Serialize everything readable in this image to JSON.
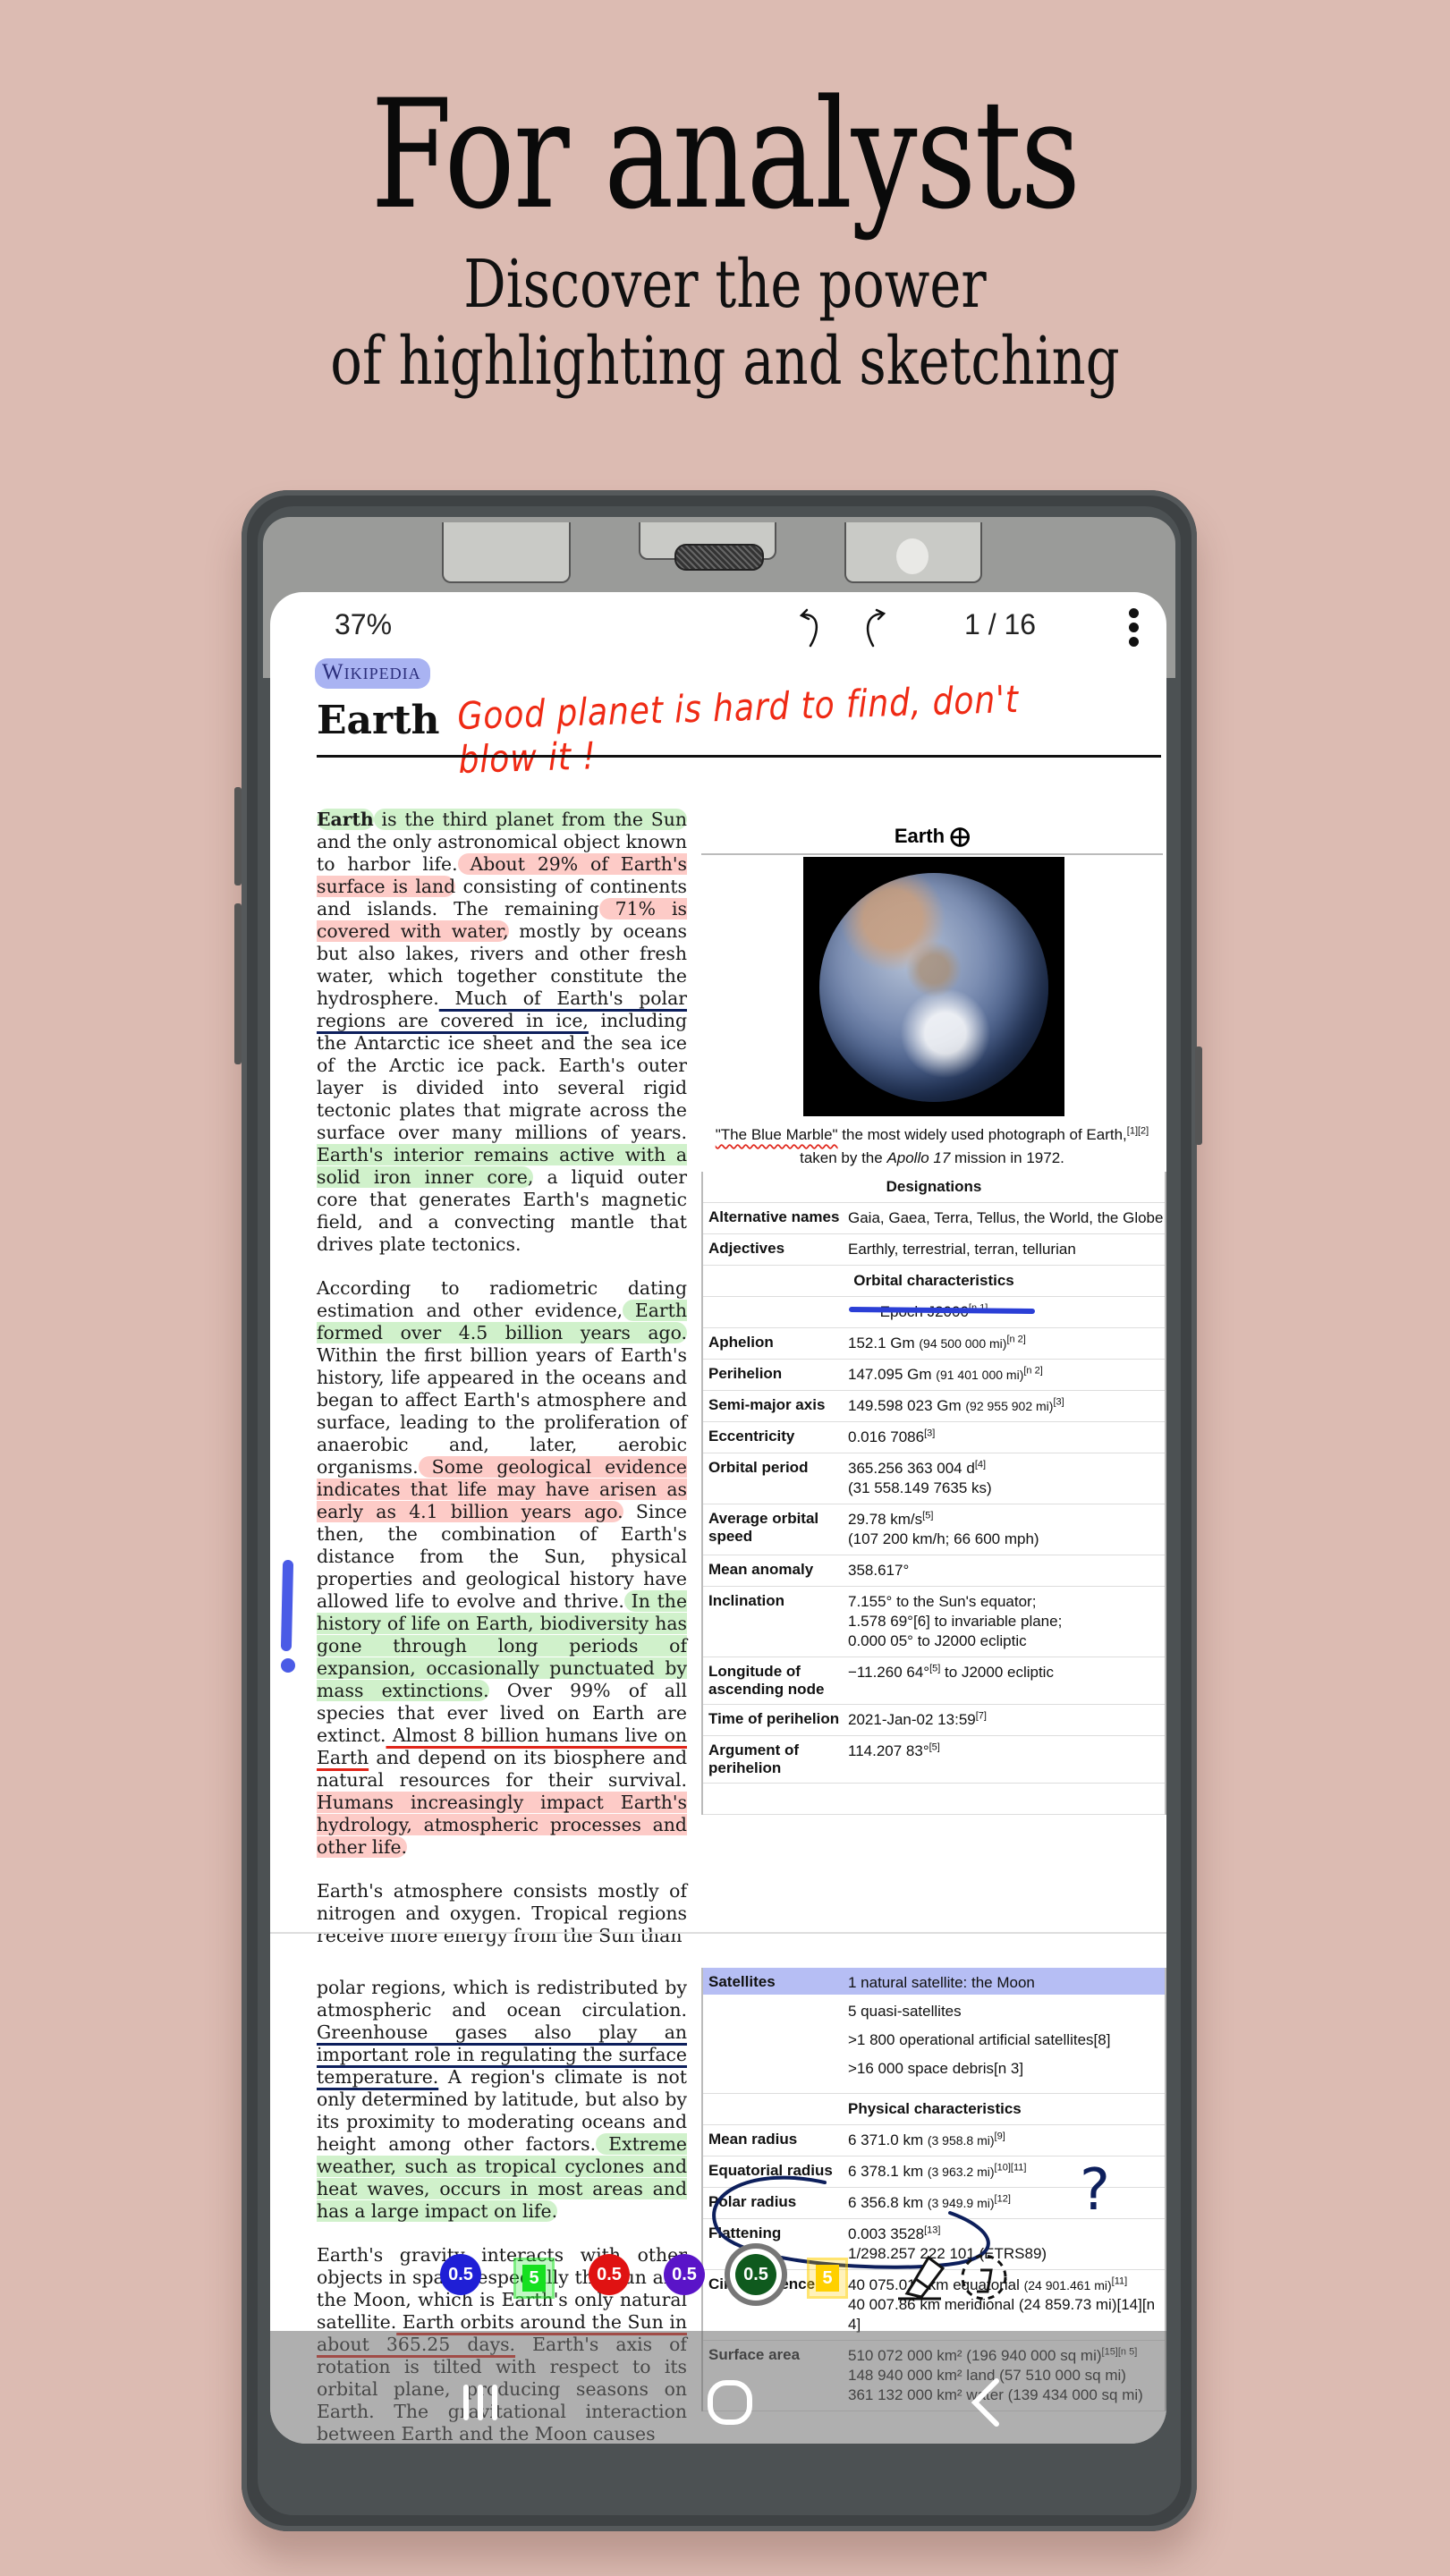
{
  "hero": {
    "title": "For analysts",
    "subtitle_line1": "Discover the power",
    "subtitle_line2": "of highlighting and sketching"
  },
  "viewer": {
    "zoom_level": "37%",
    "page_indicator": "1 / 16",
    "undo_icon": "undo-icon",
    "redo_icon": "redo-icon",
    "menu_icon": "kebab-menu-icon"
  },
  "article": {
    "logo": "Wikipedia",
    "title": "Earth",
    "handwritten_note": "Good planet is hard to find, don't blow it !",
    "annotation_colors": {
      "green_highlight": "#96e18c",
      "red_highlight": "#fa8c82",
      "blue_highlight": "#a9b3f2",
      "navy_pen": "#0d1f5c",
      "red_pen": "#e0251a",
      "blue_marker": "#4a5be6"
    },
    "paragraphs": [
      {
        "segments": [
          {
            "t": "Earth",
            "s": "bold hl-green"
          },
          {
            "t": " is the third planet from the Sun",
            "s": "hl-green"
          },
          {
            "t": " and the only astronomical object known to harbor life.",
            "s": ""
          },
          {
            "t": " About 29% of Earth's surface is land",
            "s": "hl-red"
          },
          {
            "t": " consisting of continents and islands. The remaining",
            "s": ""
          },
          {
            "t": " 71% is covered with water,",
            "s": "hl-red"
          },
          {
            "t": " mostly by oceans but also lakes, rivers and other fresh water, which together constitute the hydrosphere.",
            "s": ""
          },
          {
            "t": " Much of Earth's polar regions are covered in ice,",
            "s": "ul-navy"
          },
          {
            "t": " including the Antarctic ice sheet and the sea ice of the Arctic ice pack. Earth's outer layer is divided into several rigid tectonic plates that migrate across the surface over many millions of years.",
            "s": ""
          },
          {
            "t": " Earth's interior remains active with a solid iron inner core,",
            "s": "hl-green"
          },
          {
            "t": " a liquid outer core that generates Earth's magnetic field, and a convecting mantle that drives plate tectonics.",
            "s": ""
          }
        ]
      },
      {
        "segments": [
          {
            "t": "According to radiometric dating estimation and other evidence,",
            "s": ""
          },
          {
            "t": " Earth formed over 4.5 billion years ago.",
            "s": "hl-green"
          },
          {
            "t": " Within the first billion years of Earth's history, life appeared in the oceans and began to affect Earth's atmosphere and surface, leading to the proliferation of anaerobic and, later, aerobic organisms.",
            "s": ""
          },
          {
            "t": " Some geological evidence indicates that life may have arisen as early as 4.1 billion years ago.",
            "s": "hl-red"
          },
          {
            "t": " Since then, the combination of Earth's distance from the Sun, physical properties and geological history have allowed life to evolve and thrive.",
            "s": ""
          },
          {
            "t": " In the history of life on Earth, biodiversity has gone through long periods of expansion, occasionally punctuated by mass extinctions.",
            "s": "hl-green"
          },
          {
            "t": " Over 99% of all species that ever lived on Earth are extinct.",
            "s": ""
          },
          {
            "t": " Almost 8 billion humans live on Earth",
            "s": "ul-red"
          },
          {
            "t": " and depend on its biosphere and natural resources for their survival.",
            "s": ""
          },
          {
            "t": " Humans increasingly impact Earth's hydrology, atmospheric processes and other life.",
            "s": "hl-red"
          }
        ]
      },
      {
        "segments": [
          {
            "t": "Earth's atmosphere consists mostly of nitrogen and oxygen. Tropical regions receive more energy from the Sun than",
            "s": ""
          }
        ]
      }
    ],
    "page2_paragraphs": [
      {
        "segments": [
          {
            "t": "polar regions, which is redistributed by atmospheric and ocean circulation.",
            "s": ""
          },
          {
            "t": " Greenhouse gases also play an important role in regulating the surface temperature.",
            "s": "ul-navy"
          },
          {
            "t": " A region's climate is not only determined by latitude, but also by its proximity to moderating oceans and height among other factors.",
            "s": ""
          },
          {
            "t": " Extreme weather, such as tropical cyclones and heat waves, occurs in most areas and has a large impact on life.",
            "s": "hl-green"
          }
        ]
      },
      {
        "segments": [
          {
            "t": "Earth's gravity interacts with other objects in space, especially the Sun and the Moon, which is Earth's only natural satellite.",
            "s": ""
          },
          {
            "t": " Earth orbits around the Sun in about 365.25 days.",
            "s": "ul-red"
          },
          {
            "t": " Earth's axis of rotation is tilted with respect to its orbital plane, producing seasons on Earth. The gravitational interaction between Earth and the Moon causes",
            "s": ""
          }
        ]
      }
    ],
    "infobox": {
      "title": "Earth",
      "title_symbol": "⨁",
      "image_alt": "The Blue Marble photograph of Earth",
      "caption_marked": "\"The Blue Marble\"",
      "caption_rest": " the most widely used photograph of Earth,",
      "caption_refs": "[1][2]",
      "caption_tail": " taken by the ",
      "caption_mission": "Apollo 17",
      "caption_end": " mission in 1972.",
      "designations_header": "Designations",
      "designations": [
        {
          "label": "Alternative names",
          "value": "Gaia, Gaea, Terra, Tellus, the World, the Globe"
        },
        {
          "label": "Adjectives",
          "value": "Earthly, terrestrial, terran, tellurian"
        }
      ],
      "orbital_header": "Orbital characteristics",
      "epoch": "Epoch J2000",
      "epoch_ref": "[n 1]",
      "orbital": [
        {
          "label": "Aphelion",
          "value": "152.1 Gm",
          "small": "(94 500 000 mi)",
          "ref": "[n 2]"
        },
        {
          "label": "Perihelion",
          "value": "147.095 Gm",
          "small": "(91 401 000 mi)",
          "ref": "[n 2]"
        },
        {
          "label": "Semi-major axis",
          "value": "149.598 023 Gm",
          "small": "(92 955 902 mi)",
          "ref": "[3]"
        },
        {
          "label": "Eccentricity",
          "value": "0.016 7086",
          "small": "",
          "ref": "[3]"
        },
        {
          "label": "Orbital period",
          "value": "365.256 363 004 d",
          "small": "",
          "ref": "[4]",
          "line2": "(31 558.149 7635 ks)"
        },
        {
          "label": "Average orbital speed",
          "value": "29.78 km/s",
          "small": "",
          "ref": "[5]",
          "line2": "(107 200 km/h; 66 600 mph)"
        },
        {
          "label": "Mean anomaly",
          "value": "358.617°",
          "small": "",
          "ref": ""
        },
        {
          "label": "Inclination",
          "value": "7.155° to the Sun's equator;",
          "small": "",
          "ref": "",
          "line2": "1.578 69°[6] to invariable plane;",
          "line3": "0.000 05° to J2000 ecliptic"
        },
        {
          "label": "Longitude of ascending node",
          "value": "−11.260 64°",
          "small": "",
          "ref": "[5]",
          "after": " to J2000 ecliptic"
        },
        {
          "label": "Time of perihelion",
          "value": "2021-Jan-02 13:59",
          "small": "",
          "ref": "[7]"
        },
        {
          "label": "Argument of perihelion",
          "value": "114.207 83°",
          "small": "",
          "ref": "[5]"
        }
      ],
      "satellites_label": "Satellites",
      "satellites": [
        "1 natural satellite: the Moon",
        "5 quasi-satellites",
        ">1 800 operational artificial satellites[8]",
        ">16 000 space debris[n 3]"
      ],
      "physical_header": "Physical characteristics",
      "physical": [
        {
          "label": "Mean radius",
          "value": "6 371.0 km",
          "small": "(3 958.8 mi)",
          "ref": "[9]"
        },
        {
          "label": "Equatorial radius",
          "value": "6 378.1 km",
          "small": "(3 963.2 mi)",
          "ref": "[10][11]"
        },
        {
          "label": "Polar radius",
          "value": "6 356.8 km",
          "small": "(3 949.9 mi)",
          "ref": "[12]"
        },
        {
          "label": "Flattening",
          "value": "0.003 3528",
          "small": "",
          "ref": "[13]",
          "line2": "1/298.257 222 101 (ETRS89)"
        },
        {
          "label": "Circumference",
          "value": "40 075.017 km equatorial",
          "small": "(24 901.461 mi)",
          "ref": "[11]",
          "line2": "40 007.86 km meridional (24 859.73 mi)[14][n 4]"
        },
        {
          "label": "Surface area",
          "value": "510 072 000 km² (196 940 000 sq mi)",
          "small": "",
          "ref": "[15][n 5]",
          "line2": "148 940 000 km² land (57 510 000 sq mi)",
          "line3": "361 132 000 km² water (139 434 000 sq mi)"
        }
      ],
      "sketch_question": "?"
    }
  },
  "tools": {
    "pens": [
      {
        "name": "pen-blue",
        "value": "0.5",
        "color": "#1f1fd6",
        "kind": "pen"
      },
      {
        "name": "highlighter-green",
        "value": "5",
        "color": "#16e020",
        "kind": "highlighter"
      },
      {
        "name": "pen-red",
        "value": "0.5",
        "color": "#e01212",
        "kind": "pen"
      },
      {
        "name": "pen-purple",
        "value": "0.5",
        "color": "#5a14c8",
        "kind": "pen"
      },
      {
        "name": "pen-dark-green",
        "value": "0.5",
        "color": "#0f5a1e",
        "kind": "pen",
        "selected": true
      },
      {
        "name": "highlighter-yellow",
        "value": "5",
        "color": "#ffd000",
        "kind": "highlighter"
      }
    ],
    "eraser_icon": "eraser-icon",
    "lasso_icon": "lasso-select-icon"
  },
  "system_nav": {
    "recents_icon": "recents-icon",
    "home_icon": "home-icon",
    "back_icon": "back-icon"
  }
}
